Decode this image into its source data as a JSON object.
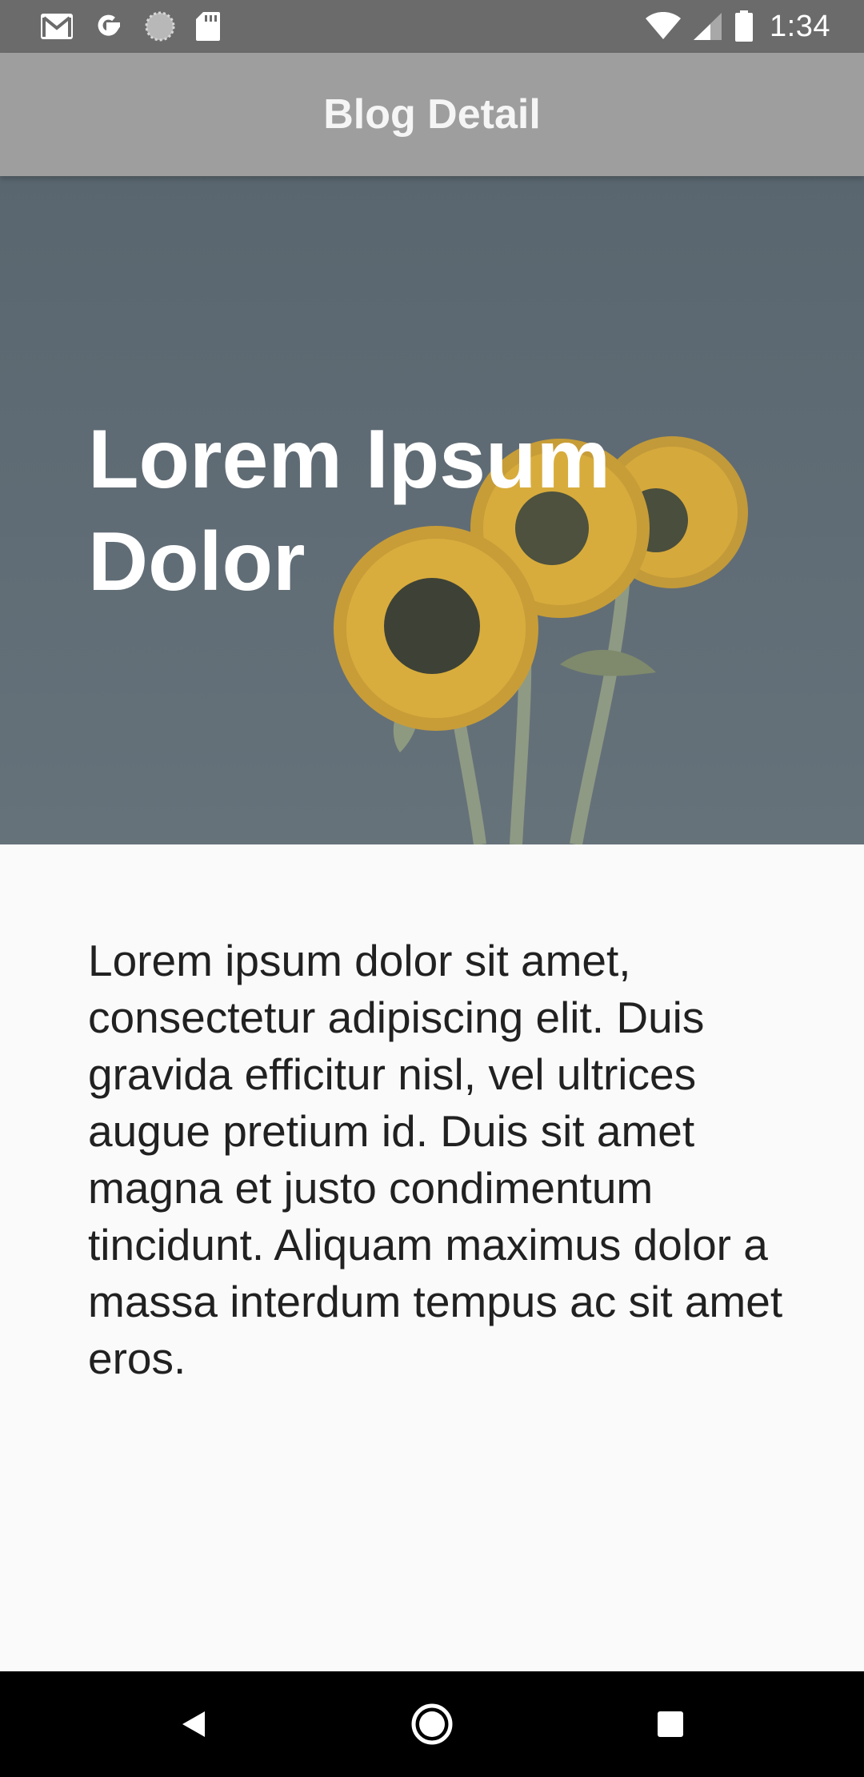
{
  "status_bar": {
    "time": "1:34",
    "left_icons": [
      "gmail-icon",
      "google-icon",
      "loading-icon",
      "sd-card-icon"
    ],
    "right_icons": [
      "wifi-icon",
      "cell-signal-icon",
      "battery-icon"
    ]
  },
  "app_bar": {
    "title": "Blog Detail",
    "background": "#9e9e9e"
  },
  "hero": {
    "title": "Lorem Ipsum\nDolor",
    "image": "sunflowers"
  },
  "article": {
    "body": "Lorem ipsum dolor sit amet, consectetur adipiscing elit. Duis gravida efficitur nisl, vel ultrices augue pretium id. Duis sit amet magna et justo condimentum tincidunt. Aliquam maximus dolor a massa interdum tempus ac sit amet eros."
  },
  "nav_bar": {
    "buttons": [
      "back-icon",
      "home-icon",
      "recents-icon"
    ]
  }
}
